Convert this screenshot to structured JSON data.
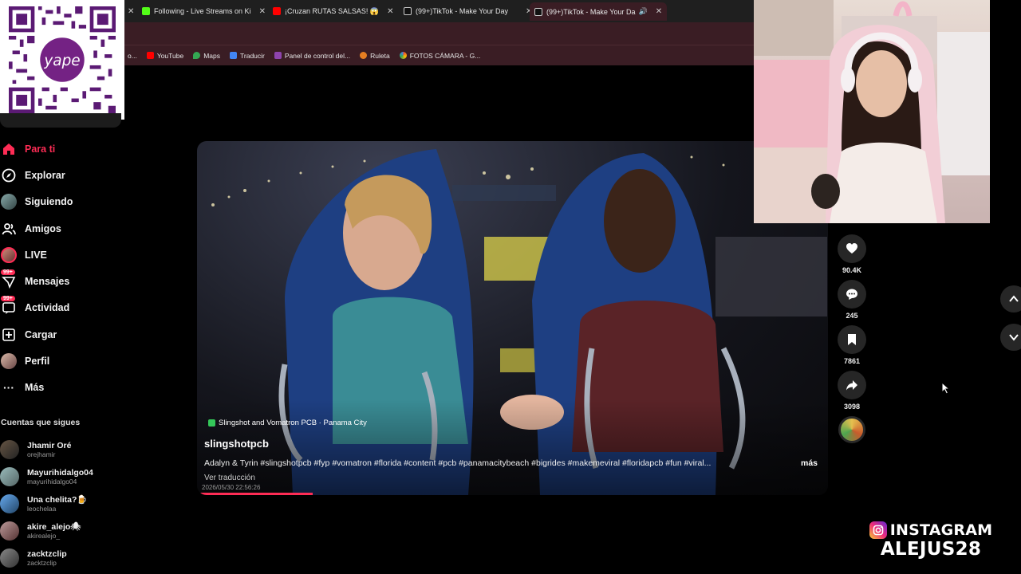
{
  "browser": {
    "tabs": [
      {
        "label": "Following - Live Streams on Ki",
        "icon": "kick-icon",
        "color": "#53fc18"
      },
      {
        "label": "¡Cruzan RUTAS SALSAS! 😱",
        "icon": "youtube-icon",
        "color": "#ff0000"
      },
      {
        "label": "(99+)TikTok - Make Your Day",
        "icon": "tiktok-icon",
        "color": "#ffffff"
      },
      {
        "label": "(99+)TikTok - Make Your Da",
        "icon": "tiktok-icon",
        "color": "#ffffff"
      }
    ],
    "new_tab": "+",
    "bookmarks": [
      {
        "label": "YouTube",
        "color": "#ff0000"
      },
      {
        "label": "Maps",
        "color": "#34a853"
      },
      {
        "label": "Traducir",
        "color": "#4285f4"
      },
      {
        "label": "Panel de control del...",
        "color": "#8e44ad"
      },
      {
        "label": "Ruleta",
        "color": "#e67e22"
      },
      {
        "label": "FOTOS CÁMARA - G...",
        "color": "#f4b400"
      }
    ],
    "bookmark_prefix": "o..."
  },
  "sidebar": {
    "items": [
      {
        "label": "Para ti",
        "icon": "home-icon",
        "active": true
      },
      {
        "label": "Explorar",
        "icon": "compass-icon"
      },
      {
        "label": "Siguiendo",
        "icon": "avatar-icon"
      },
      {
        "label": "Amigos",
        "icon": "friends-icon"
      },
      {
        "label": "LIVE",
        "icon": "live-avatar-icon"
      },
      {
        "label": "Mensajes",
        "icon": "messages-icon",
        "badge": "99+"
      },
      {
        "label": "Actividad",
        "icon": "activity-icon",
        "badge": "99+"
      },
      {
        "label": "Cargar",
        "icon": "upload-icon"
      },
      {
        "label": "Perfil",
        "icon": "profile-avatar-icon"
      },
      {
        "label": "Más",
        "icon": "more-icon"
      }
    ],
    "following_title": "Cuentas que sigues",
    "following": [
      {
        "name": "Jhamir Oré",
        "handle": "orejhamir"
      },
      {
        "name": "Mayurihidalgo04",
        "handle": "mayurihidalgo04"
      },
      {
        "name": "Una chelita?🍺",
        "handle": "leochelaa"
      },
      {
        "name": "akire_alejo🕷",
        "handle": "akirealejo_"
      },
      {
        "name": "zacktzclip",
        "handle": "zacktzclip"
      }
    ]
  },
  "video": {
    "location": "Slingshot and Vomatron PCB · Panama City",
    "author": "slingshotpcb",
    "caption": "Adalyn & Tyrin #slingshotpcb #fyp #vomatron #florida #content #pcb #panamacitybeach #bigrides #makemeviral #floridapcb #fun #viral...",
    "more": "más",
    "translate": "Ver traducción",
    "date": "2026/05/30 22:56:26",
    "progress": 0.18
  },
  "actions": [
    {
      "icon": "heart-icon",
      "count": "90.4K"
    },
    {
      "icon": "comment-icon",
      "count": "245"
    },
    {
      "icon": "bookmark-icon",
      "count": "7861"
    },
    {
      "icon": "share-icon",
      "count": "3098"
    }
  ],
  "overlay": {
    "instagram_label": "INSTAGRAM",
    "instagram_handle": "ALEJUS28"
  },
  "colors": {
    "accent": "#fe2c55",
    "chrome": "#3a1d24"
  }
}
